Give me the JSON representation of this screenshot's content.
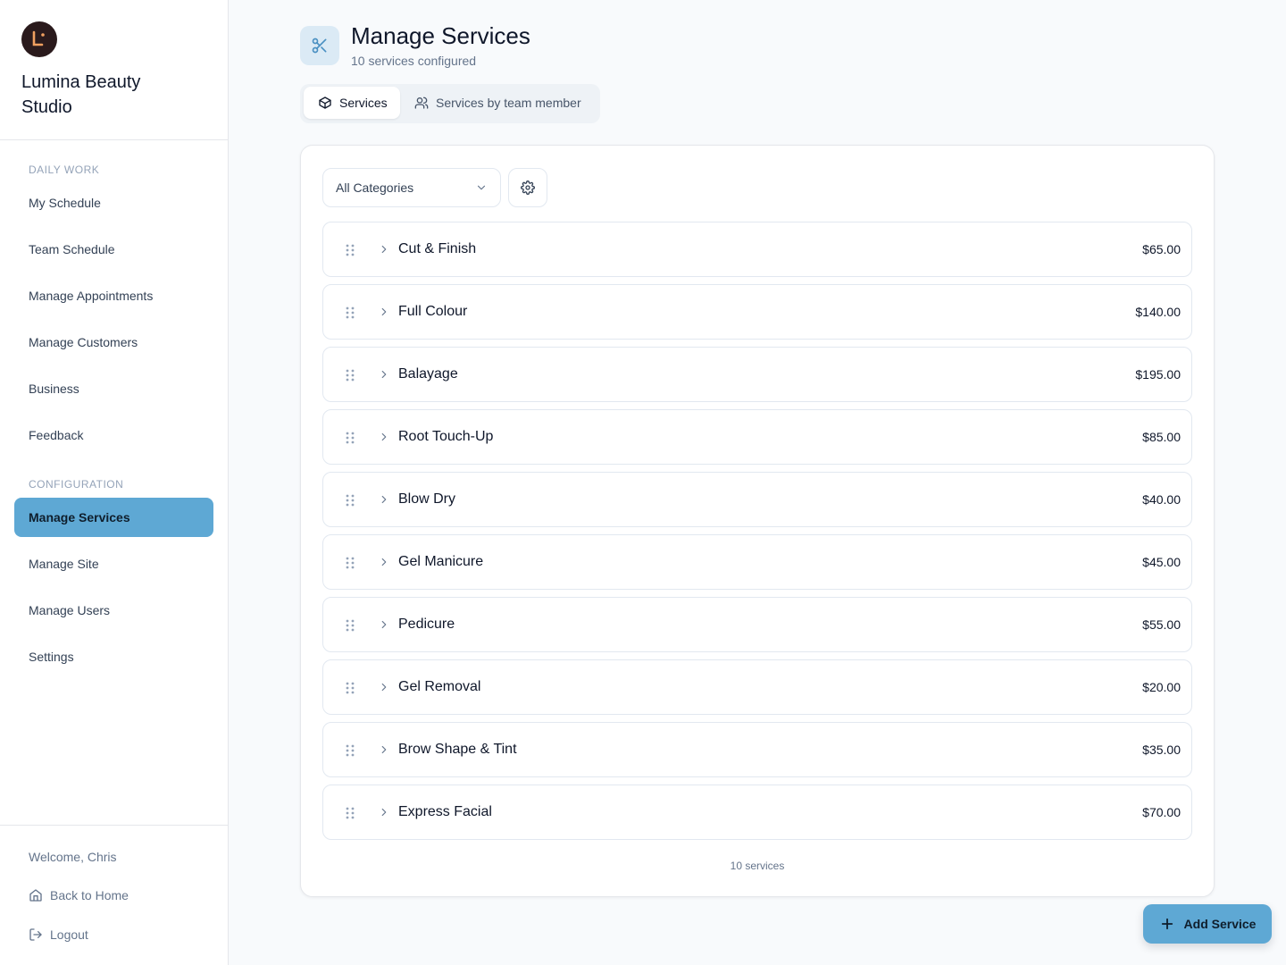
{
  "brand": {
    "name": "Lumina Beauty Studio",
    "logo_letter": "L"
  },
  "sidebar": {
    "sections": [
      {
        "title": "DAILY WORK",
        "items": [
          "My Schedule",
          "Team Schedule",
          "Manage Appointments",
          "Manage Customers",
          "Business",
          "Feedback"
        ]
      },
      {
        "title": "CONFIGURATION",
        "items": [
          "Manage Services",
          "Manage Site",
          "Manage Users",
          "Settings"
        ]
      }
    ],
    "active_item": "Manage Services",
    "footer": {
      "welcome": "Welcome, Chris",
      "home_link": "Back to Home",
      "logout_link": "Logout"
    }
  },
  "header": {
    "title": "Manage Services",
    "subtitle": "10 services configured",
    "icon": "scissors-icon"
  },
  "tabs": [
    {
      "label": "Services",
      "icon": "box-icon",
      "active": true
    },
    {
      "label": "Services by team member",
      "icon": "users-icon",
      "active": false
    }
  ],
  "filter": {
    "category_value": "All Categories"
  },
  "services": [
    {
      "name": "Cut & Finish",
      "price": "$65.00"
    },
    {
      "name": "Full Colour",
      "price": "$140.00"
    },
    {
      "name": "Balayage",
      "price": "$195.00"
    },
    {
      "name": "Root Touch-Up",
      "price": "$85.00"
    },
    {
      "name": "Blow Dry",
      "price": "$40.00"
    },
    {
      "name": "Gel Manicure",
      "price": "$45.00"
    },
    {
      "name": "Pedicure",
      "price": "$55.00"
    },
    {
      "name": "Gel Removal",
      "price": "$20.00"
    },
    {
      "name": "Brow Shape & Tint",
      "price": "$35.00"
    },
    {
      "name": "Express Facial",
      "price": "$70.00"
    }
  ],
  "service_count": "10 services",
  "add_button": {
    "label": "Add Service"
  },
  "colors": {
    "accent": "#5ea8d4",
    "accent_light": "#dbeaf5",
    "logo_bg": "#2a1a1c",
    "logo_fg": "#f0a060"
  }
}
